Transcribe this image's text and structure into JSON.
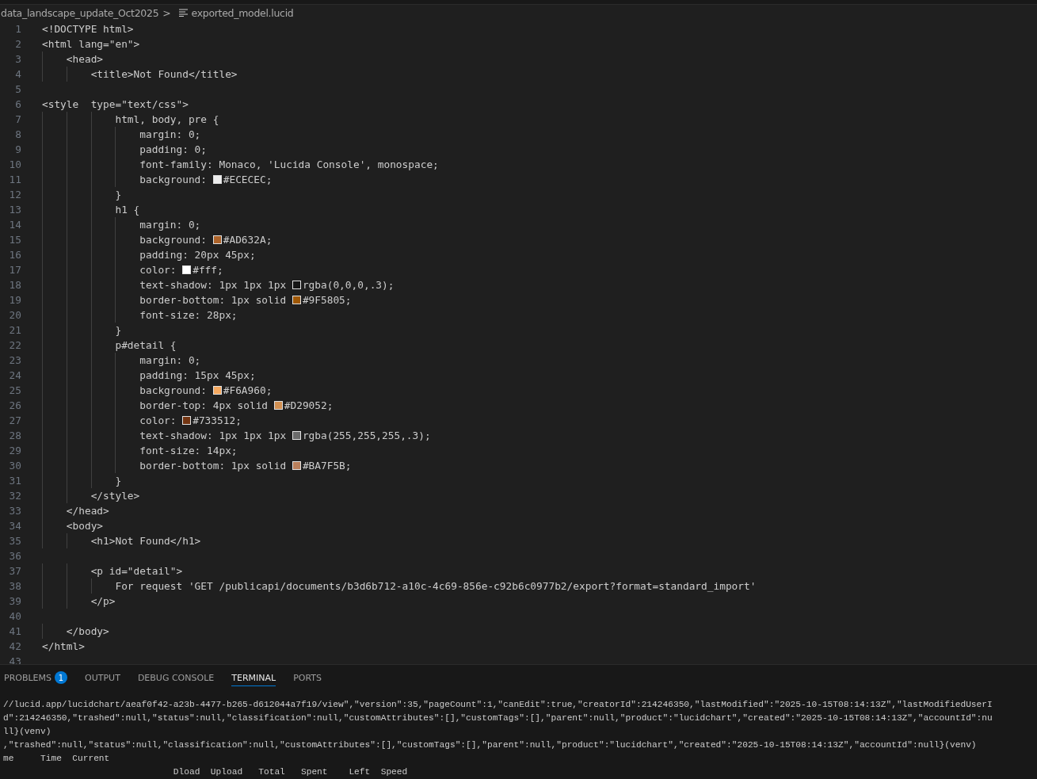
{
  "breadcrumb": {
    "folder": "data_landscape_update_Oct2025",
    "separator": ">",
    "file": "exported_model.lucid"
  },
  "editor": {
    "lines": [
      {
        "number": "1",
        "text": "<!DOCTYPE html>"
      },
      {
        "number": "2",
        "text": "<html lang=\"en\">"
      },
      {
        "number": "3",
        "text": "    <head>"
      },
      {
        "number": "4",
        "text": "        <title>Not Found</title>"
      },
      {
        "number": "5"
      },
      {
        "number": "6",
        "text": "<style  type=\"text/css\">"
      },
      {
        "number": "7",
        "text": "            html, body, pre {"
      },
      {
        "number": "8",
        "text": "                margin: 0;"
      },
      {
        "number": "9",
        "text": "                padding: 0;"
      },
      {
        "number": "10",
        "text": "                font-family: Monaco, 'Lucida Console', monospace;"
      },
      {
        "number": "11",
        "text": "                background: ",
        "color": "#ececec",
        "value": "#ECECEC;"
      },
      {
        "number": "12",
        "text": "            }"
      },
      {
        "number": "13",
        "text": "            h1 {"
      },
      {
        "number": "14",
        "text": "                margin: 0;"
      },
      {
        "number": "15",
        "text": "                background: ",
        "color": "#ad632a",
        "value": "#AD632A;"
      },
      {
        "number": "16",
        "text": "                padding: 20px 45px;"
      },
      {
        "number": "17",
        "text": "                color: ",
        "color": "#ffffff",
        "value": "#fff;"
      },
      {
        "number": "18",
        "text": "                text-shadow: 1px 1px 1px ",
        "color": "#161616",
        "value": "rgba(0,0,0,.3);"
      },
      {
        "number": "19",
        "text": "                border-bottom: 1px solid ",
        "color": "#9f5805",
        "value": "#9F5805;"
      },
      {
        "number": "20",
        "text": "                font-size: 28px;"
      },
      {
        "number": "21",
        "text": "            }"
      },
      {
        "number": "22",
        "text": "            p#detail {"
      },
      {
        "number": "23",
        "text": "                margin: 0;"
      },
      {
        "number": "24",
        "text": "                padding: 15px 45px;"
      },
      {
        "number": "25",
        "text": "                background: ",
        "color": "#f6a960",
        "value": "#F6A960;"
      },
      {
        "number": "26",
        "text": "                border-top: 4px solid ",
        "color": "#d29052",
        "value": "#D29052;"
      },
      {
        "number": "27",
        "text": "                color: ",
        "color": "#733512",
        "value": "#733512;"
      },
      {
        "number": "28",
        "text": "                text-shadow: 1px 1px 1px ",
        "color": "#6b6b6b",
        "value": "rgba(255,255,255,.3);"
      },
      {
        "number": "29",
        "text": "                font-size: 14px;"
      },
      {
        "number": "30",
        "text": "                border-bottom: 1px solid ",
        "color": "#ba7f5b",
        "value": "#BA7F5B;"
      },
      {
        "number": "31",
        "text": "            }"
      },
      {
        "number": "32",
        "text": "        </style>"
      },
      {
        "number": "33",
        "text": "    </head>"
      },
      {
        "number": "34",
        "text": "    <body>"
      },
      {
        "number": "35",
        "text": "        <h1>Not Found</h1>"
      },
      {
        "number": "36"
      },
      {
        "number": "37",
        "text": "        <p id=\"detail\">"
      },
      {
        "number": "38",
        "text": "            For request 'GET /publicapi/documents/b3d6b712-a10c-4c69-856e-c92b6c0977b2/export?format=standard_import'"
      },
      {
        "number": "39",
        "text": "        </p>"
      },
      {
        "number": "40"
      },
      {
        "number": "41",
        "text": "    </body>"
      },
      {
        "number": "42",
        "text": "</html>"
      },
      {
        "number": "43"
      }
    ]
  },
  "panel": {
    "tabs": [
      {
        "label": "PROBLEMS",
        "badge": "1",
        "selected": false
      },
      {
        "label": "OUTPUT",
        "selected": false
      },
      {
        "label": "DEBUG CONSOLE",
        "selected": false
      },
      {
        "label": "TERMINAL",
        "selected": true
      },
      {
        "label": "PORTS",
        "selected": false
      }
    ],
    "terminal_lines": [
      "//lucid.app/lucidchart/aeaf0f42-a23b-4477-b265-d612044a7f19/view\",\"version\":35,\"pageCount\":1,\"canEdit\":true,\"creatorId\":214246350,\"lastModified\":\"2025-10-15T08:14:13Z\",\"lastModifiedUserI",
      "d\":214246350,\"trashed\":null,\"status\":null,\"classification\":null,\"customAttributes\":[],\"customTags\":[],\"parent\":null,\"product\":\"lucidchart\",\"created\":\"2025-10-15T08:14:13Z\",\"accountId\":nu",
      "ll}(venv)",
      ",\"trashed\":null,\"status\":null,\"classification\":null,\"customAttributes\":[],\"customTags\":[],\"parent\":null,\"product\":\"lucidchart\",\"created\":\"2025-10-15T08:14:13Z\",\"accountId\":null}(venv)",
      "me     Time  Current",
      "                                Dload  Upload   Total   Spent    Left  Speed"
    ]
  }
}
